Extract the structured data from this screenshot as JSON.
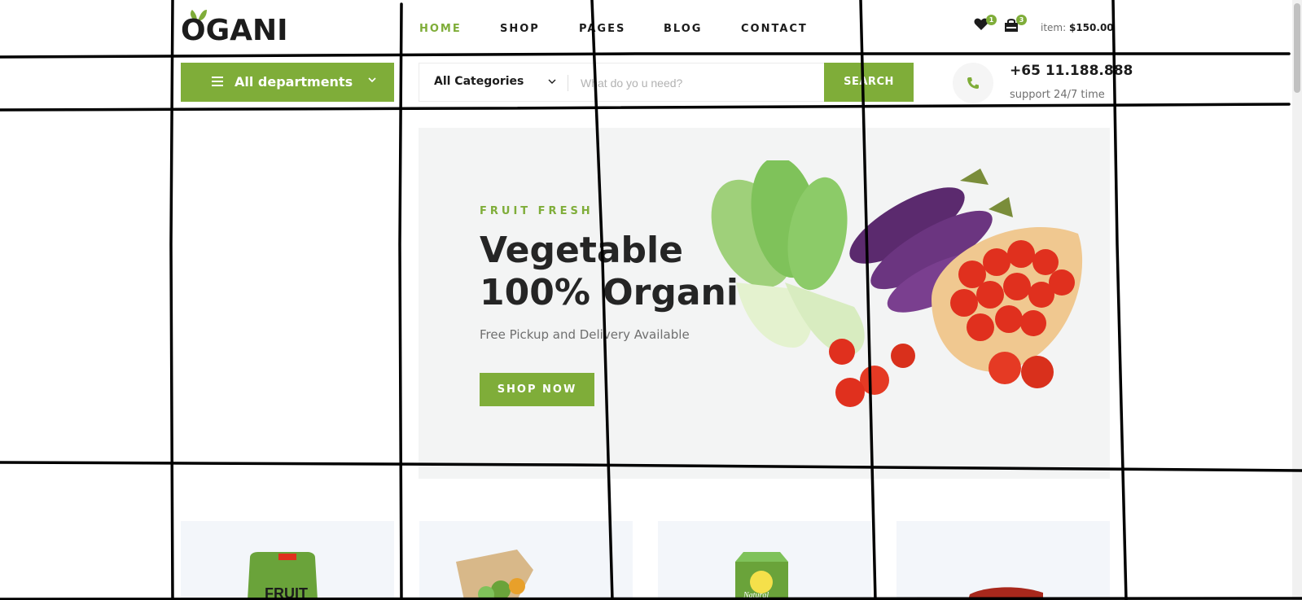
{
  "brand": {
    "logo_text": "OGANI",
    "accent": "#7fad39"
  },
  "nav": {
    "items": [
      {
        "label": "HOME",
        "active": true
      },
      {
        "label": "SHOP",
        "active": false
      },
      {
        "label": "PAGES",
        "active": false
      },
      {
        "label": "BLOG",
        "active": false
      },
      {
        "label": "CONTACT",
        "active": false
      }
    ]
  },
  "header_icons": {
    "wishlist_icon": "heart-icon",
    "wishlist_count": "1",
    "cart_icon": "shopping-bag-icon",
    "cart_count": "3",
    "cart_label": "item:",
    "cart_total": "$150.00"
  },
  "departments": {
    "label": "All departments"
  },
  "search": {
    "category_selected": "All Categories",
    "placeholder": "What do yo u need?",
    "button_label": "SEARCH"
  },
  "contact": {
    "phone_icon": "phone-icon",
    "phone": "+65 11.188.888",
    "support": "support 24/7 time"
  },
  "hero": {
    "eyebrow": "FRUIT FRESH",
    "title_line1": "Vegetable",
    "title_line2": "100% Organic",
    "subtitle": "Free Pickup and Delivery Available",
    "cta": "SHOP NOW"
  },
  "category_tiles": [
    {
      "name": "fruit-package",
      "label": "FRUIT"
    },
    {
      "name": "paper-bag-greens"
    },
    {
      "name": "juice-box",
      "label": "Natural"
    },
    {
      "name": "meat"
    }
  ]
}
